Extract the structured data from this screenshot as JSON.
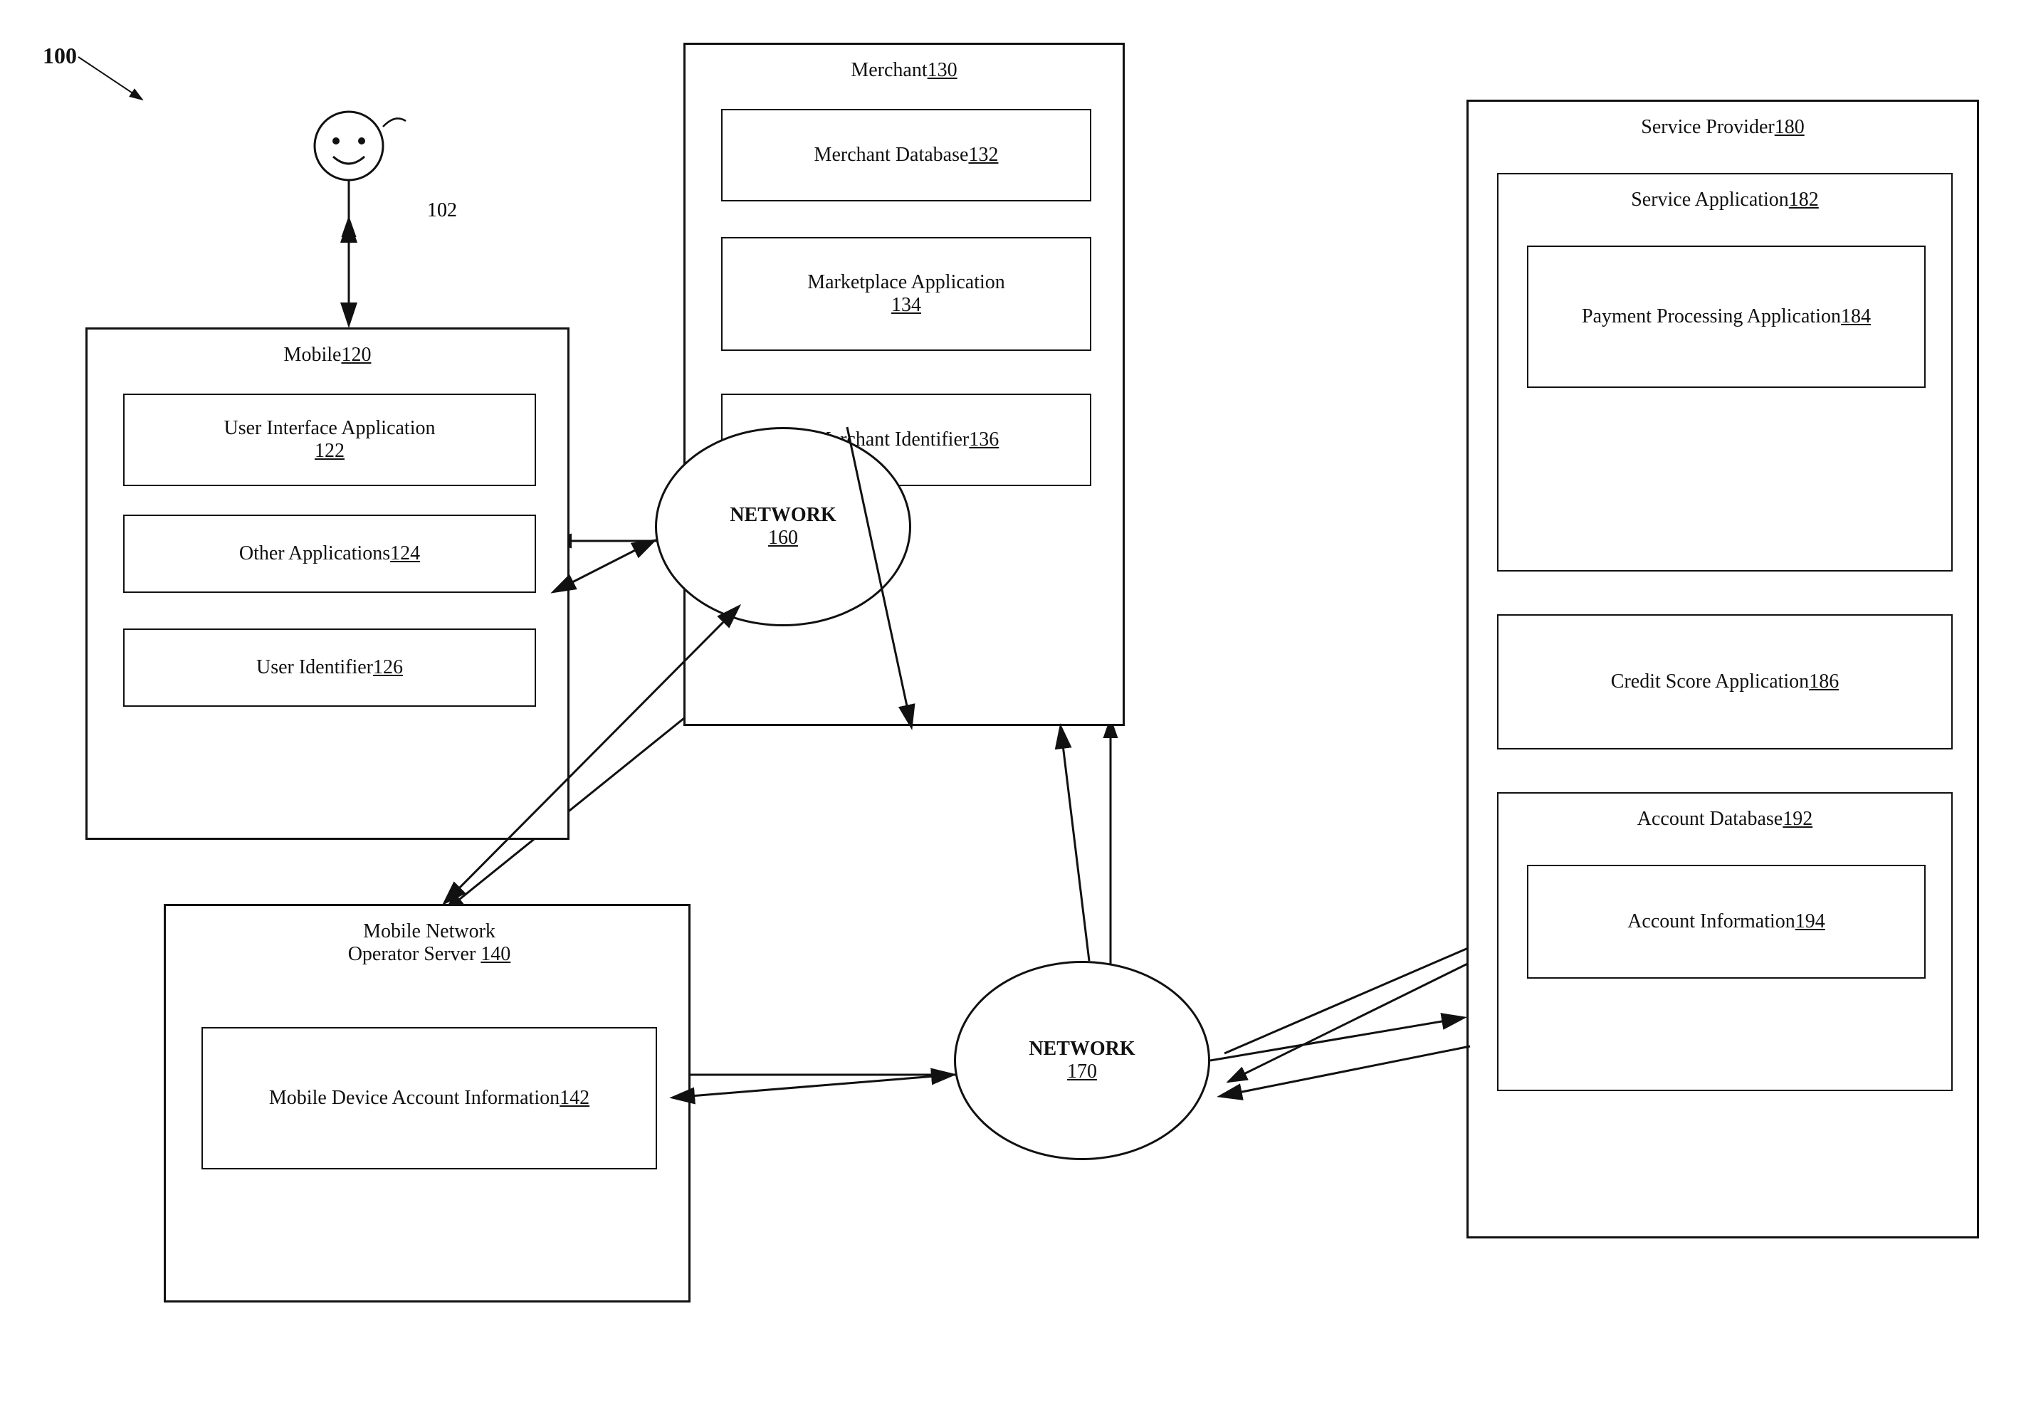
{
  "diagram": {
    "figure_number": "100",
    "person_label": "102",
    "mobile": {
      "outer_label": "Mobile",
      "outer_number": "120",
      "ui_app_label": "User Interface Application",
      "ui_app_number": "122",
      "other_apps_label": "Other Applications",
      "other_apps_number": "124",
      "user_id_label": "User Identifier",
      "user_id_number": "126"
    },
    "merchant": {
      "outer_label": "Merchant",
      "outer_number": "130",
      "db_label": "Merchant Database",
      "db_number": "132",
      "marketplace_label": "Marketplace Application",
      "marketplace_number": "134",
      "id_label": "Merchant Identifier",
      "id_number": "136"
    },
    "network160": {
      "label": "NETWORK",
      "number": "160"
    },
    "mno": {
      "outer_label": "Mobile Network\nOperator Server",
      "outer_number": "140",
      "info_label": "Mobile Device Account\nInformation",
      "info_number": "142"
    },
    "network170": {
      "label": "NETWORK",
      "number": "170"
    },
    "service_provider": {
      "outer_label": "Service Provider",
      "outer_number": "180",
      "service_app_label": "Service Application",
      "service_app_number": "182",
      "payment_label": "Payment Processing\nApplication",
      "payment_number": "184",
      "credit_label": "Credit Score Application",
      "credit_number": "186",
      "account_db_label": "Account Database",
      "account_db_number": "192",
      "account_info_label": "Account Information",
      "account_info_number": "194"
    }
  }
}
